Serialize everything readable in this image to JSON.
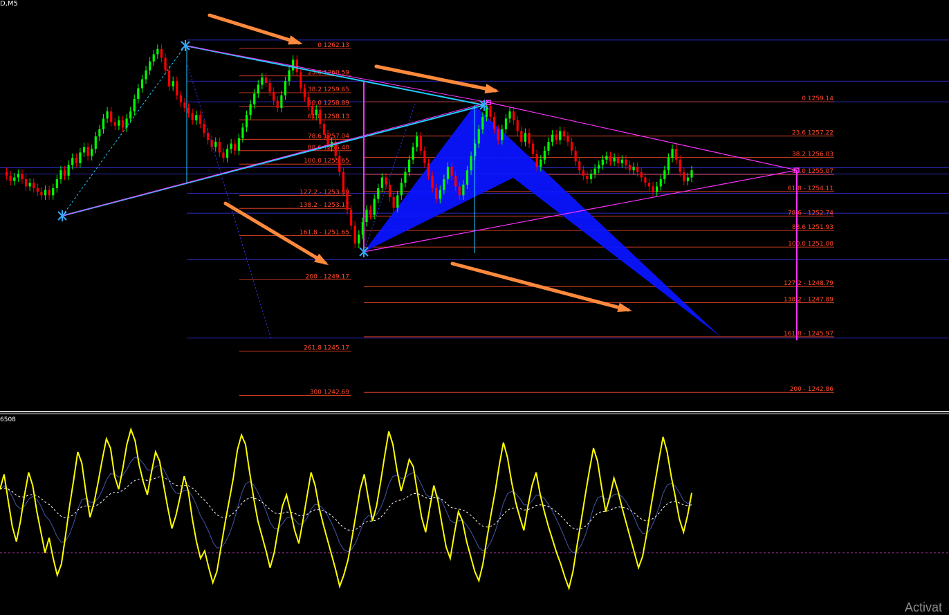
{
  "window": {
    "title": "D,M5",
    "subwindow_label": "6508",
    "watermark": "Activat"
  },
  "colors": {
    "background": "#000000",
    "bull_candle": "#00ff00",
    "bear_candle": "#ff0000",
    "fib_level": "#ff4a2a",
    "grid_blue": "#3a3aff",
    "pattern_fill": "#0a14ff",
    "trendline_magenta": "#ff33ff",
    "trendline_cyan": "#22ccff",
    "arrow_orange": "#ff8a3d",
    "oscillator_main": "#ffff00",
    "oscillator_signal": "#ffffff"
  },
  "chart_data": {
    "type": "candlestick",
    "timeframe": "M5",
    "price_range": [
      1241.5,
      1265.0
    ],
    "horizontal_blue_levels": [
      1262.6,
      1260.3,
      1259.14,
      1255.45,
      1255.1,
      1254.0,
      1252.9,
      1250.3,
      1245.9
    ],
    "fib_retracement_left": [
      {
        "label": "0 1262.13",
        "price": 1262.13
      },
      {
        "label": "23.6 1260.59",
        "price": 1260.59
      },
      {
        "label": "38.2 1259.65",
        "price": 1259.65
      },
      {
        "label": "50.0 1258.89",
        "price": 1258.89
      },
      {
        "label": "61.8 1258.13",
        "price": 1258.13
      },
      {
        "label": "78.6 1257.04",
        "price": 1257.04
      },
      {
        "label": "88.6 1256.40",
        "price": 1256.4
      },
      {
        "label": "100.0 1255.65",
        "price": 1255.65
      },
      {
        "label": "127.2 - 1253.89",
        "price": 1253.89
      },
      {
        "label": "138.2 - 1253.17",
        "price": 1253.17
      },
      {
        "label": "161.8 - 1251.65",
        "price": 1251.65
      },
      {
        "label": "200 - 1249.17",
        "price": 1249.17
      },
      {
        "label": "261.8 1245.17",
        "price": 1245.17
      },
      {
        "label": "300 1242.69",
        "price": 1242.69
      }
    ],
    "fib_retracement_right": [
      {
        "label": "0 1259.14",
        "price": 1259.14
      },
      {
        "label": "23.6 1257.22",
        "price": 1257.22
      },
      {
        "label": "38.2 1256.03",
        "price": 1256.03
      },
      {
        "label": "50.0 1255.07",
        "price": 1255.07
      },
      {
        "label": "61.8 - 1254.11",
        "price": 1254.11
      },
      {
        "label": "78.6 - 1252.74",
        "price": 1252.74
      },
      {
        "label": "88.6 1251.93",
        "price": 1251.93
      },
      {
        "label": "100.0 1251.00",
        "price": 1251.0
      },
      {
        "label": "127.2 - 1248.79",
        "price": 1248.79
      },
      {
        "label": "138.2 - 1247.89",
        "price": 1247.89
      },
      {
        "label": "161.8 - 1245.97",
        "price": 1245.97
      },
      {
        "label": "200 - 1242.86",
        "price": 1242.86
      }
    ],
    "price_path": [
      1255.2,
      1255.0,
      1254.7,
      1254.9,
      1255.1,
      1254.8,
      1254.4,
      1254.6,
      1254.3,
      1254.1,
      1253.9,
      1254.2,
      1253.9,
      1254.3,
      1254.8,
      1255.3,
      1255.0,
      1255.6,
      1256.0,
      1255.7,
      1256.3,
      1256.6,
      1256.1,
      1256.5,
      1257.2,
      1257.6,
      1258.2,
      1258.6,
      1258.0,
      1257.8,
      1258.1,
      1257.7,
      1258.2,
      1258.6,
      1259.3,
      1259.9,
      1260.4,
      1260.9,
      1261.4,
      1261.8,
      1262.1,
      1261.6,
      1260.9,
      1260.0,
      1260.3,
      1259.5,
      1259.1,
      1258.8,
      1258.5,
      1258.1,
      1258.4,
      1257.9,
      1257.4,
      1257.0,
      1256.6,
      1256.9,
      1256.3,
      1256.0,
      1256.5,
      1256.8,
      1256.4,
      1257.1,
      1257.7,
      1258.4,
      1259.0,
      1259.6,
      1260.1,
      1260.5,
      1260.2,
      1259.7,
      1259.2,
      1258.8,
      1259.5,
      1260.3,
      1260.9,
      1261.5,
      1260.8,
      1259.9,
      1259.4,
      1258.9,
      1258.4,
      1258.7,
      1257.9,
      1257.3,
      1256.6,
      1256.9,
      1256.1,
      1255.2,
      1254.1,
      1253.1,
      1252.2,
      1251.2,
      1251.7,
      1252.4,
      1253.1,
      1252.8,
      1253.7,
      1254.3,
      1254.9,
      1254.5,
      1253.8,
      1253.2,
      1253.9,
      1254.6,
      1255.2,
      1255.9,
      1256.6,
      1257.2,
      1256.4,
      1255.7,
      1255.0,
      1254.3,
      1253.7,
      1254.2,
      1254.8,
      1255.5,
      1255.0,
      1254.4,
      1253.9,
      1254.5,
      1255.3,
      1256.1,
      1256.8,
      1257.6,
      1258.3,
      1258.9,
      1258.3,
      1257.6,
      1257.0,
      1257.6,
      1258.2,
      1258.6,
      1258.1,
      1257.5,
      1256.9,
      1257.4,
      1256.8,
      1256.2,
      1255.5,
      1255.9,
      1256.4,
      1256.9,
      1257.3,
      1257.0,
      1257.5,
      1257.2,
      1256.9,
      1256.4,
      1255.8,
      1255.3,
      1255.0,
      1254.8,
      1255.1,
      1255.4,
      1255.6,
      1255.9,
      1256.1,
      1255.8,
      1256.0,
      1255.7,
      1255.9,
      1255.6,
      1255.3,
      1255.5,
      1255.2,
      1254.9,
      1254.6,
      1254.4,
      1254.1,
      1254.4,
      1254.8,
      1255.3,
      1256.0,
      1256.5,
      1255.9,
      1255.2,
      1254.7,
      1254.9,
      1255.3
    ]
  },
  "oscillator_data": {
    "type": "stochastic",
    "main_line": [
      64,
      72,
      58,
      44,
      36,
      47,
      61,
      73,
      66,
      52,
      41,
      30,
      38,
      27,
      18,
      24,
      39,
      55,
      69,
      84,
      78,
      62,
      49,
      57,
      68,
      80,
      91,
      86,
      71,
      64,
      75,
      88,
      96,
      90,
      77,
      68,
      61,
      73,
      84,
      79,
      66,
      54,
      43,
      50,
      60,
      71,
      63,
      48,
      36,
      27,
      31,
      22,
      14,
      20,
      33,
      46,
      58,
      70,
      85,
      93,
      88,
      73,
      59,
      47,
      39,
      31,
      22,
      30,
      43,
      55,
      61,
      52,
      42,
      35,
      47,
      60,
      73,
      66,
      54,
      45,
      37,
      29,
      21,
      12,
      18,
      26,
      38,
      51,
      64,
      72,
      59,
      47,
      55,
      68,
      82,
      95,
      88,
      74,
      63,
      71,
      80,
      76,
      62,
      49,
      41,
      54,
      66,
      58,
      45,
      33,
      27,
      40,
      52,
      47,
      36,
      28,
      20,
      15,
      24,
      38,
      51,
      63,
      77,
      89,
      81,
      68,
      57,
      49,
      42,
      55,
      66,
      73,
      61,
      52,
      44,
      37,
      30,
      24,
      17,
      11,
      20,
      34,
      47,
      61,
      74,
      86,
      79,
      65,
      52,
      60,
      70,
      63,
      54,
      46,
      38,
      30,
      22,
      28,
      40,
      54,
      67,
      80,
      92,
      84,
      71,
      60,
      48,
      41,
      50,
      62
    ]
  }
}
